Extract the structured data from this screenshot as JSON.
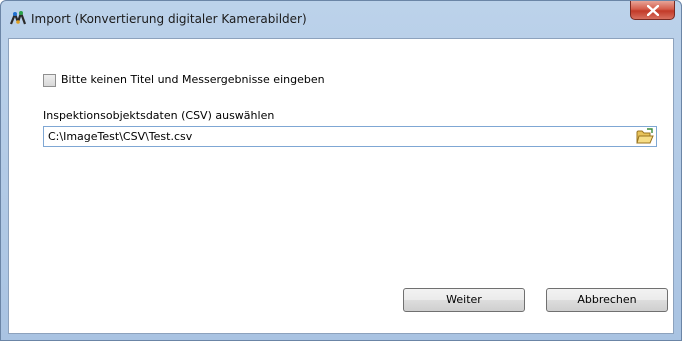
{
  "window": {
    "title": "Import (Konvertierung digitaler Kamerabilder)"
  },
  "form": {
    "checkbox_label": "Bitte keinen Titel und Messergebnisse eingeben",
    "checkbox_checked": false,
    "field_label": "Inspektionsobjektsdaten (CSV) auswählen",
    "path_value": "C:\\ImageTest\\CSV\\Test.csv"
  },
  "buttons": {
    "next": "Weiter",
    "cancel": "Abbrechen"
  },
  "icons": {
    "app": "camera-app-icon",
    "browse": "folder-open-icon",
    "close": "close-icon"
  },
  "colors": {
    "close_button": "#c23a28",
    "input_border": "#7fa7d4",
    "frame": "#bcd2ea"
  }
}
